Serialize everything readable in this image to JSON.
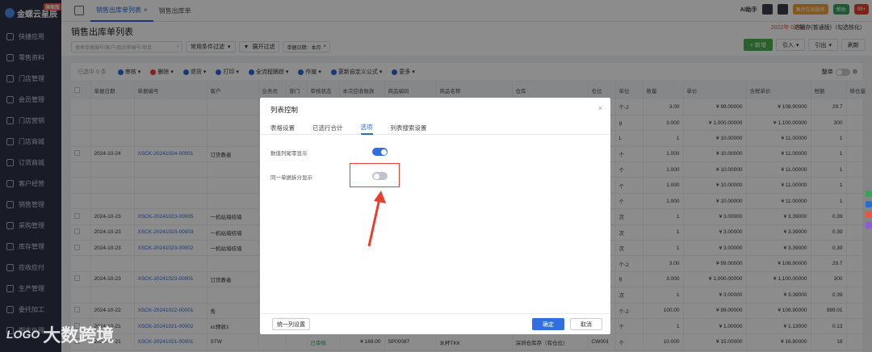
{
  "sidebar": {
    "logo": "金蝶云星辰",
    "logo_badge": "旗舰版",
    "items": [
      {
        "label": "快捷应用"
      },
      {
        "label": "零售资料"
      },
      {
        "label": "门店管理"
      },
      {
        "label": "会员管理"
      },
      {
        "label": "门店营销"
      },
      {
        "label": "门店商城"
      },
      {
        "label": "订货商城"
      },
      {
        "label": "客户经营"
      },
      {
        "label": "销售管理"
      },
      {
        "label": "采购管理"
      },
      {
        "label": "库存管理"
      },
      {
        "label": "应收应付"
      },
      {
        "label": "生产管理"
      },
      {
        "label": "委托加工"
      },
      {
        "label": "期末处理"
      }
    ]
  },
  "topbar": {
    "tabs": [
      {
        "label": "销售出库单列表",
        "active": true
      },
      {
        "label": "销售出库单",
        "active": false
      }
    ],
    "ai_label": "AI助手",
    "service_label": "售后在线服务",
    "help_label": "帮助",
    "notify_count": "99+"
  },
  "page": {
    "title": "销售出库单列表",
    "period": "2022年 01 期",
    "stock_mode": "进销存(普通版)（勾选核化）"
  },
  "filterbar": {
    "search_placeholder": "搜索单据编号/客户/商品等编号/项目",
    "common_filter": "常用条件过滤",
    "expand_filter": "展开过滤",
    "date_chip": "单据日期：本月",
    "new_label": "+ 新增",
    "import_label": "引入",
    "export_label": "引出",
    "refresh_label": "刷新"
  },
  "actionbar": {
    "selected": "已选中 0 条",
    "items": [
      {
        "label": "审核",
        "color": "#2a6ad8"
      },
      {
        "label": "删除",
        "color": "#e8402f"
      },
      {
        "label": "退货",
        "color": "#2a6ad8"
      },
      {
        "label": "打印",
        "color": "#2a6ad8"
      },
      {
        "label": "全流程跟踪",
        "color": "#2a6ad8"
      },
      {
        "label": "作废",
        "color": "#2a6ad8"
      },
      {
        "label": "更新自定义公式",
        "color": "#2a6ad8"
      },
      {
        "label": "更多",
        "color": "#2a6ad8"
      }
    ],
    "sort_label": "整单"
  },
  "table": {
    "columns": [
      "",
      "单据日期",
      "单据编号",
      "客户",
      "业务员",
      "部门",
      "审核状态",
      "本次应收账款",
      "商品编码",
      "商品名称",
      "仓库",
      "仓位",
      "单位",
      "数量",
      "单价",
      "含税单价",
      "税额",
      "移仓量"
    ],
    "rows": [
      [
        "",
        "",
        "",
        "",
        "",
        "",
        "",
        "",
        "",
        "",
        "",
        "",
        "个-2",
        "3.00",
        "¥ 99.00000",
        "¥ 108.90000",
        "29.7",
        ""
      ],
      [
        "",
        "",
        "",
        "",
        "",
        "",
        "",
        "",
        "",
        "",
        "",
        "",
        "g",
        "3.000",
        "¥ 1,000.00000",
        "¥ 1,100.00000",
        "300",
        ""
      ],
      [
        "",
        "",
        "",
        "",
        "",
        "",
        "",
        "",
        "",
        "",
        "",
        "",
        "L",
        "1",
        "¥ 10.00000",
        "¥ 11.00000",
        "1",
        ""
      ],
      [
        "",
        "2024-10-24",
        "XSCK-20241024-00001",
        "订货教者",
        "",
        "",
        "",
        "",
        "",
        "",
        "",
        "",
        "个",
        "1.000",
        "¥ 10.00000",
        "¥ 11.00000",
        "1",
        ""
      ],
      [
        "",
        "",
        "",
        "",
        "",
        "",
        "",
        "",
        "",
        "",
        "",
        "",
        "个",
        "1.000",
        "¥ 10.00000",
        "¥ 11.00000",
        "1",
        ""
      ],
      [
        "",
        "",
        "",
        "",
        "",
        "",
        "",
        "",
        "",
        "",
        "",
        "",
        "个",
        "1.000",
        "¥ 10.00000",
        "¥ 11.00000",
        "1",
        ""
      ],
      [
        "",
        "",
        "",
        "",
        "",
        "",
        "",
        "",
        "",
        "",
        "",
        "",
        "个",
        "1.000",
        "¥ 10.00000",
        "¥ 11.00000",
        "1",
        ""
      ],
      [
        "",
        "2024-10-23",
        "XSCK-20241023-00005",
        "一机站墙结墙",
        "",
        "",
        "",
        "",
        "",
        "",
        "",
        "",
        "次",
        "1",
        "¥ 3.00000",
        "¥ 3.39000",
        "0.39",
        ""
      ],
      [
        "",
        "2024-10-23",
        "XSCK-20241023-00003",
        "一机站墙结墙",
        "",
        "",
        "",
        "",
        "",
        "",
        "",
        "",
        "次",
        "1",
        "¥ 3.00000",
        "¥ 3.39000",
        "0.39",
        ""
      ],
      [
        "",
        "2024-10-23",
        "XSCK-20241023-00002",
        "一机站墙结墙",
        "",
        "",
        "",
        "",
        "",
        "",
        "",
        "",
        "次",
        "1",
        "¥ 3.00000",
        "¥ 3.39000",
        "0.39",
        ""
      ],
      [
        "",
        "",
        "",
        "",
        "",
        "",
        "",
        "",
        "",
        "",
        "",
        "",
        "个-2",
        "3.00",
        "¥ 99.00000",
        "¥ 108.90000",
        "29.7",
        ""
      ],
      [
        "",
        "2024-10-23",
        "XSCK-20241023-00001",
        "订货教者",
        "",
        "",
        "",
        "",
        "",
        "",
        "",
        "",
        "g",
        "3.000",
        "¥ 1,000.00000",
        "¥ 1,100.00000",
        "300",
        ""
      ],
      [
        "",
        "",
        "",
        "",
        "",
        "",
        "",
        "",
        "",
        "",
        "",
        "",
        "次",
        "1",
        "¥ 3.00000",
        "¥ 3.39000",
        "0.39",
        ""
      ],
      [
        "",
        "2024-10-22",
        "XSCK-20241022-00001",
        "秀",
        "",
        "",
        "",
        "",
        "",
        "",
        "",
        "",
        "个-2",
        "100.00",
        "¥ 99.00000",
        "¥ 108.90000",
        "989.01",
        ""
      ],
      [
        "",
        "2024-10-21",
        "XSCK-20241021-00002",
        "xc预收1",
        "",
        "",
        "",
        "",
        "",
        "",
        "",
        "",
        "个",
        "1",
        "¥ 1.00000",
        "¥ 1.13000",
        "0.13",
        ""
      ],
      [
        "",
        "2024-10-21",
        "XSCK-20241021-00001",
        "STW",
        "",
        "",
        "已审核",
        "¥ 168.00",
        "SP00087",
        "水杯TKK",
        "深圳仓库存（有仓位）",
        "CW001",
        "个",
        "10.000",
        "¥ 15.00000",
        "¥ 16.80000",
        "18",
        ""
      ]
    ]
  },
  "dialog": {
    "title": "列表控制",
    "close_icon": "×",
    "tabs": [
      {
        "label": "表格设置",
        "active": false
      },
      {
        "label": "已选行合计",
        "active": false
      },
      {
        "label": "选项",
        "active": true
      },
      {
        "label": "列表搜索设置",
        "active": false
      }
    ],
    "options": [
      {
        "label": "数值列尾零显示",
        "on": true
      },
      {
        "label": "同一单据拆分显示",
        "on": false
      }
    ],
    "unify_label": "统一列设置",
    "ok_label": "确定",
    "cancel_label": "取消",
    "highlight_color": "#e8402f"
  },
  "watermark": {
    "logo": "LOGO",
    "text": "大数跨境"
  }
}
